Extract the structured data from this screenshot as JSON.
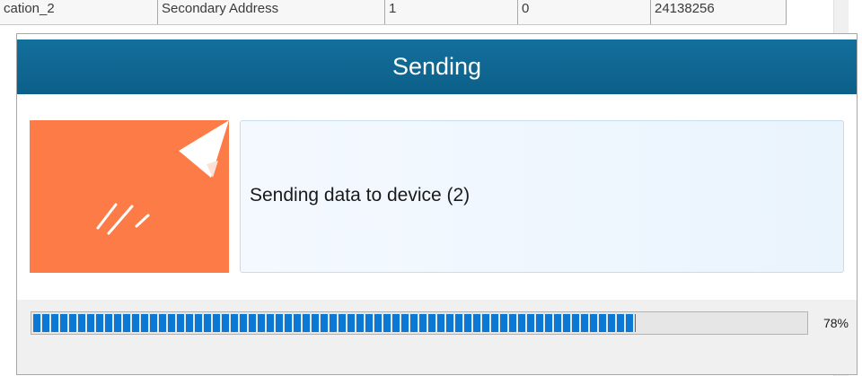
{
  "background_table": {
    "cells": [
      "cation_2",
      "Secondary Address",
      "1",
      "0",
      "24138256"
    ]
  },
  "dialog": {
    "title": "Sending",
    "message": "Sending data to device (2)",
    "progress": {
      "value_percent": 78,
      "label": "78%"
    }
  },
  "icons": {
    "tile_icon": "paper-plane-icon"
  },
  "colors": {
    "title_bar": "#0c6089",
    "tile_background": "#fd7b46",
    "progress_fill": "#0b78d6"
  }
}
